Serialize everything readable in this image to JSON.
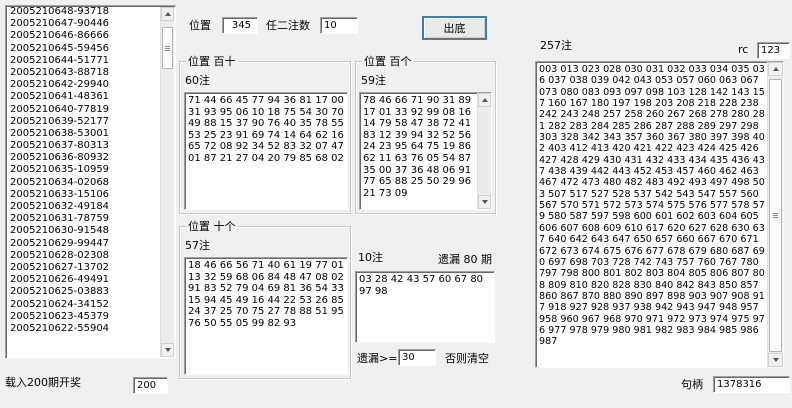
{
  "history_list": {
    "items": [
      "2005210648-93718",
      "2005210647-90446",
      "2005210646-86666",
      "2005210645-59456",
      "2005210644-51771",
      "2005210643-88718",
      "2005210642-29940",
      "2005210641-48361",
      "2005210640-77819",
      "2005210639-52177",
      "2005210638-53001",
      "2005210637-80313",
      "2005210636-80932",
      "2005210635-10959",
      "2005210634-02068",
      "2005210633-15106",
      "2005210632-49184",
      "2005210631-78759",
      "2005210630-91548",
      "2005210629-99447",
      "2005210628-02308",
      "2005210627-13702",
      "2005210626-49491",
      "2005210625-03883",
      "2005210624-34152",
      "2005210623-45379",
      "2005210622-55904"
    ]
  },
  "load_label": "载入200期开奖",
  "load_count": "200",
  "position_label": "位置",
  "position_value": "345",
  "choose_two_label": "任二注数",
  "choose_two_value": "10",
  "reveal_button": "出底",
  "group_bai_shi": {
    "title": "位置 百十",
    "count": "60注",
    "text": "71 44 66 45 77 94 36 81 17 00 31 93 95 06 10 18 75 54 30 70 49 88 15 37 90 76 40 35 78 55 53 25 23 91 69 74 14 64 62 16 65 72 08 92 34 52 83 32 07 47 01 87 21 27 04 20 79 85 68 02"
  },
  "group_bai_ge": {
    "title": "位置 百个",
    "count": "59注",
    "text": "78 46 66 71 90 31 89 17 01 33 92 99 08 16 14 79 58 47 38 72 41 83 12 39 94 32 52 56 24 23 95 64 75 19 86 62 11 63 76 05 54 87 35 00 37 36 48 06 91 77 65 88 25 50 29 96 21 73 09"
  },
  "group_shi_ge": {
    "title": "位置 十个",
    "count": "57注",
    "text": "18 46 66 56 71 40 61 19 77 01 13 32 59 68 06 84 48 47 08 02 91 83 52 79 04 69 81 36 54 33 15 94 45 49 16 44 22 53 26 85 24 37 25 70 75 27 78 88 51 95 76 50 55 05 99 82 93"
  },
  "ten_note": {
    "count": "10注",
    "missing_label": "遗漏 80 期",
    "text": "03 28 42 43 57 60 67 80 97 98"
  },
  "missing_ge_label": "遗漏>=",
  "missing_value": "30",
  "clear_label": "否则清空",
  "right_panel": {
    "count": "257注",
    "rc_label": "rc",
    "rc_value": "123",
    "text": "003 013 023 028 030 031 032 033 034 035 036 037 038 039 042 043 053 057 060 063 067 073 080 083 093 097 098 103 128 142 143 157 160 167 180 197 198 203 208 218 228 238 242 243 248 257 258 260 267 268 278 280 281 282 283 284 285 286 287 288 289 297 298 303 328 342 343 357 360 367 380 397 398 402 403 412 413 420 421 422 423 424 425 426 427 428 429 430 431 432 433 434 435 436 437 438 439 442 443 452 453 457 460 462 463 467 472 473 480 482 483 492 493 497 498 503 507 517 527 528 537 542 543 547 557 560 567 570 571 572 573 574 575 576 577 578 579 580 587 597 598 600 601 602 603 604 605 606 607 608 609 610 617 620 627 628 630 637 640 642 643 647 650 657 660 667 670 671 672 673 674 675 676 677 678 679 680 687 690 697 698 703 728 742 743 757 760 767 780 797 798 800 801 802 803 804 805 806 807 808 809 810 820 828 830 840 842 843 850 857 860 867 870 880 890 897 898 903 907 908 917 918 927 928 937 938 942 943 947 948 957 958 960 967 968 970 971 972 973 974 975 976 977 978 979 980 981 982 983 984 985 986 987"
  },
  "handle_label": "句柄",
  "handle_value": "1378316"
}
